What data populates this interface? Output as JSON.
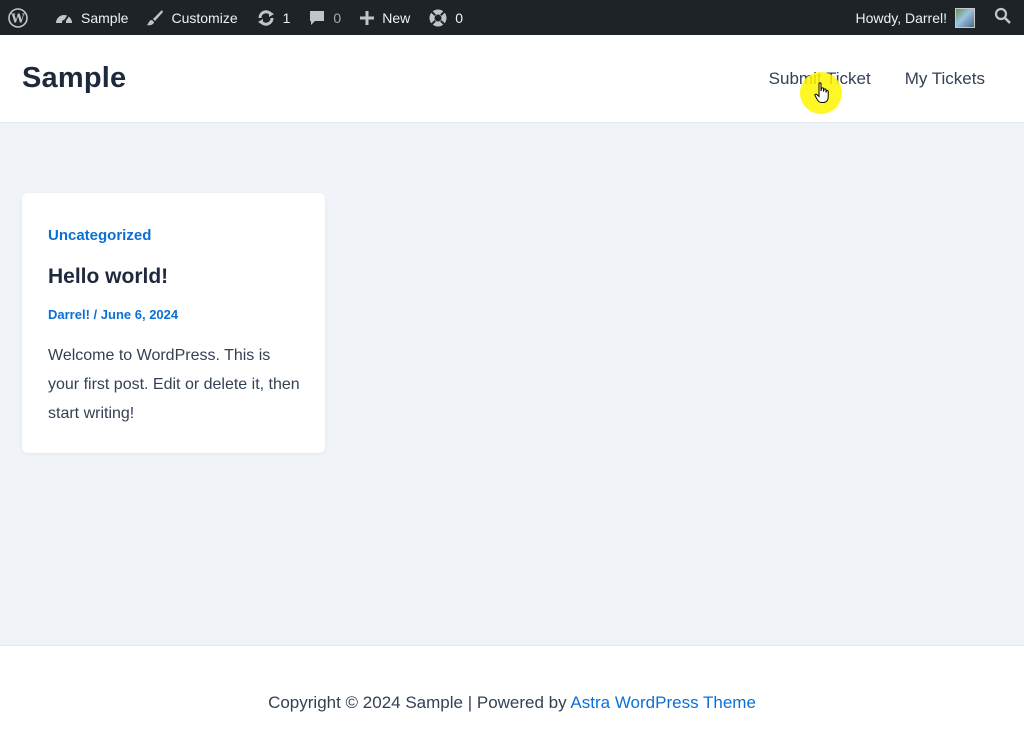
{
  "admin_bar": {
    "site_name": "Sample",
    "customize": "Customize",
    "updates_count": "1",
    "comments_count": "0",
    "new_label": "New",
    "plugin_count": "0",
    "greeting": "Howdy, Darrel!"
  },
  "header": {
    "site_title": "Sample",
    "nav": [
      "Submit Ticket",
      "My Tickets"
    ]
  },
  "post": {
    "category": "Uncategorized",
    "title": "Hello world!",
    "author": "Darrel!",
    "separator": "/",
    "date": "June 6, 2024",
    "excerpt": "Welcome to WordPress. This is your first post. Edit or delete it, then start writing!"
  },
  "footer": {
    "copyright": "Copyright © 2024 Sample | Powered by ",
    "theme_link": "Astra WordPress Theme"
  }
}
